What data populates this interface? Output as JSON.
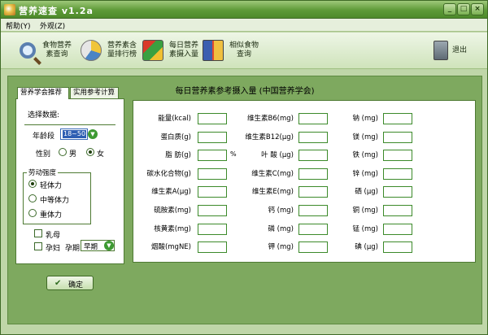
{
  "window": {
    "title": "营养速查 v1.2a",
    "minimize": "_",
    "maximize": "□",
    "close": "×"
  },
  "menu": {
    "help": "帮助(Y)",
    "view": "外观(Z)"
  },
  "toolbar": [
    {
      "name": "food-nutrition-search",
      "label": "食物营养素查询",
      "icon": "magnifier-icon"
    },
    {
      "name": "nutrient-ranking",
      "label": "营养素含量排行榜",
      "icon": "pie-chart-icon"
    },
    {
      "name": "daily-intake",
      "label": "每日营养素摄入量",
      "icon": "cubes-icon"
    },
    {
      "name": "similar-foods",
      "label": "相似食物查询",
      "icon": "book-icon"
    },
    {
      "name": "exit",
      "label": "退出",
      "icon": "exit-door-icon"
    }
  ],
  "tabs": {
    "recommend": "营养学会推荐",
    "calc": "实用参考计算"
  },
  "left": {
    "select_data": "选择数据:",
    "age_label": "年龄段",
    "age_value": "18~50",
    "sex_label": "性别",
    "male": "男",
    "female": "女",
    "labor_title": "劳动强度",
    "light": "轻体力",
    "medium": "中等体力",
    "heavy": "重体力",
    "lactating": "乳母",
    "pregnant": "孕妇",
    "pregnancy_label": "孕期",
    "pregnancy_value": "早期"
  },
  "ok_button": "确定",
  "panel_title": "每日营养素参考摄入量 (中国营养学会)",
  "nutrients": {
    "col1": [
      "能量(kcal)",
      "蛋白质(g)",
      "脂 肪(g)",
      "碳水化合物(g)",
      "维生素A(μg)",
      "硫胺素(mg)",
      "核黄素(mg)",
      "烟酸(mgNE)"
    ],
    "col2": [
      "维生素B6(mg)",
      "维生素B12(μg)",
      "叶 酸 (μg)",
      "维生素C(mg)",
      "维生素E(mg)",
      "钙 (mg)",
      "磷 (mg)",
      "钾 (mg)"
    ],
    "col3": [
      "钠 (mg)",
      "镁 (mg)",
      "铁 (mg)",
      "锌 (mg)",
      "硒 (μg)",
      "铜 (mg)",
      "锰 (mg)",
      "碘 (μg)"
    ],
    "fat_unit": "%"
  }
}
